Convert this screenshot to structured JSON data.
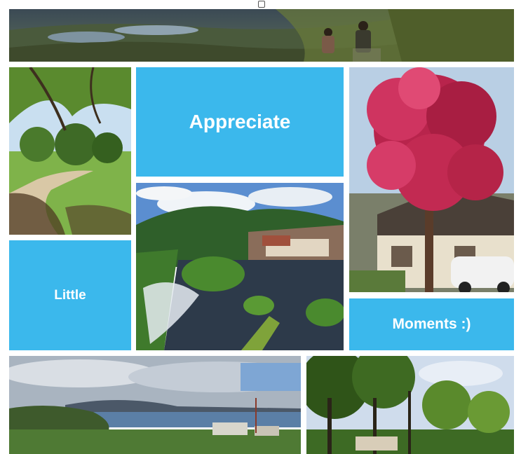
{
  "toggle": {
    "checked": false
  },
  "tiles": {
    "appreciate": "Appreciate",
    "little": "Little",
    "moments": "Moments :)"
  },
  "colors": {
    "tile_blue": "#3bb8ec",
    "text": "#ffffff"
  },
  "photos": [
    {
      "name": "photo-hikers-valley"
    },
    {
      "name": "photo-park-path"
    },
    {
      "name": "photo-blossom-tree-house"
    },
    {
      "name": "photo-river-rapids-town"
    },
    {
      "name": "photo-coast-panorama"
    },
    {
      "name": "photo-woodland-trees"
    }
  ]
}
